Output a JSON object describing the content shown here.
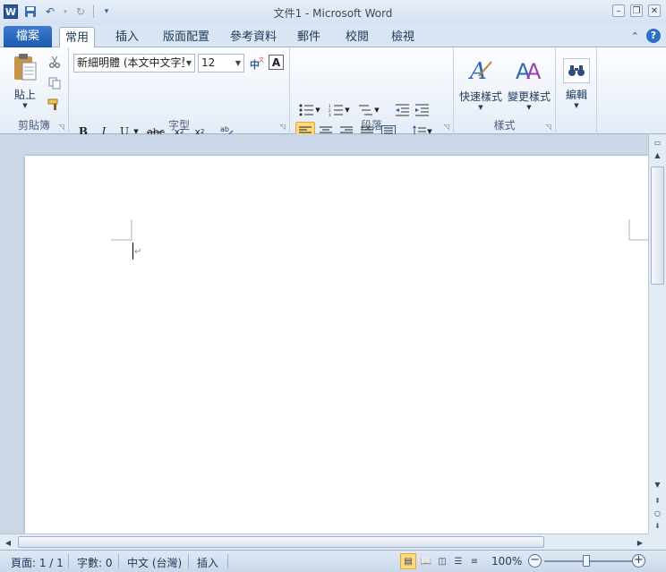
{
  "app": {
    "title": "文件1 - Microsoft Word"
  },
  "tabs": {
    "file": "檔案",
    "home": "常用",
    "insert": "插入",
    "layout": "版面配置",
    "references": "參考資料",
    "mailings": "郵件",
    "review": "校閱",
    "view": "檢視"
  },
  "clipboard": {
    "paste_label": "貼上",
    "group_label": "剪貼簿"
  },
  "font": {
    "name": "新細明體 (本文中文字型",
    "size": "12",
    "group_label": "字型"
  },
  "paragraph": {
    "group_label": "段落"
  },
  "styles": {
    "quick_styles_label": "快速樣式",
    "change_styles_label": "變更樣式",
    "group_label": "樣式"
  },
  "editing": {
    "label": "編輯"
  },
  "status": {
    "page": "頁面: 1 / 1",
    "words": "字數: 0",
    "language": "中文 (台灣)",
    "mode": "插入",
    "zoom": "100%"
  },
  "colors": {
    "file_tab": "#2b63b8",
    "accent": "#fbd97e"
  }
}
